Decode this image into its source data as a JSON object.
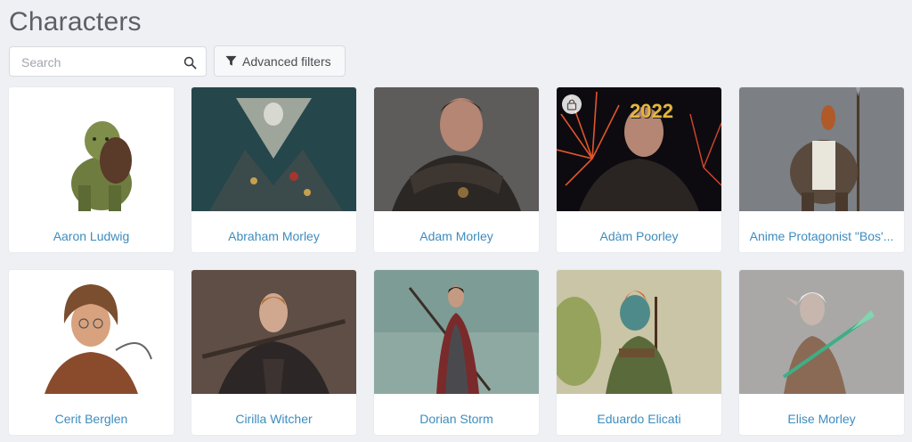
{
  "page": {
    "title": "Characters"
  },
  "search": {
    "placeholder": "Search"
  },
  "filters": {
    "label": "Advanced filters"
  },
  "cards": [
    {
      "name": "Aaron Ludwig"
    },
    {
      "name": "Abraham Morley"
    },
    {
      "name": "Adam Morley"
    },
    {
      "name": "Adàm Poorley",
      "locked": true,
      "badge": "2022"
    },
    {
      "name": "Anime Protagonist \"Bos'..."
    },
    {
      "name": "Cerit Berglen"
    },
    {
      "name": "Cirilla Witcher"
    },
    {
      "name": "Dorian Storm"
    },
    {
      "name": "Eduardo Elicati"
    },
    {
      "name": "Elise Morley"
    }
  ],
  "colors": {
    "link": "#3d8cbf",
    "background": "#eef0f3",
    "card": "#ffffff"
  }
}
